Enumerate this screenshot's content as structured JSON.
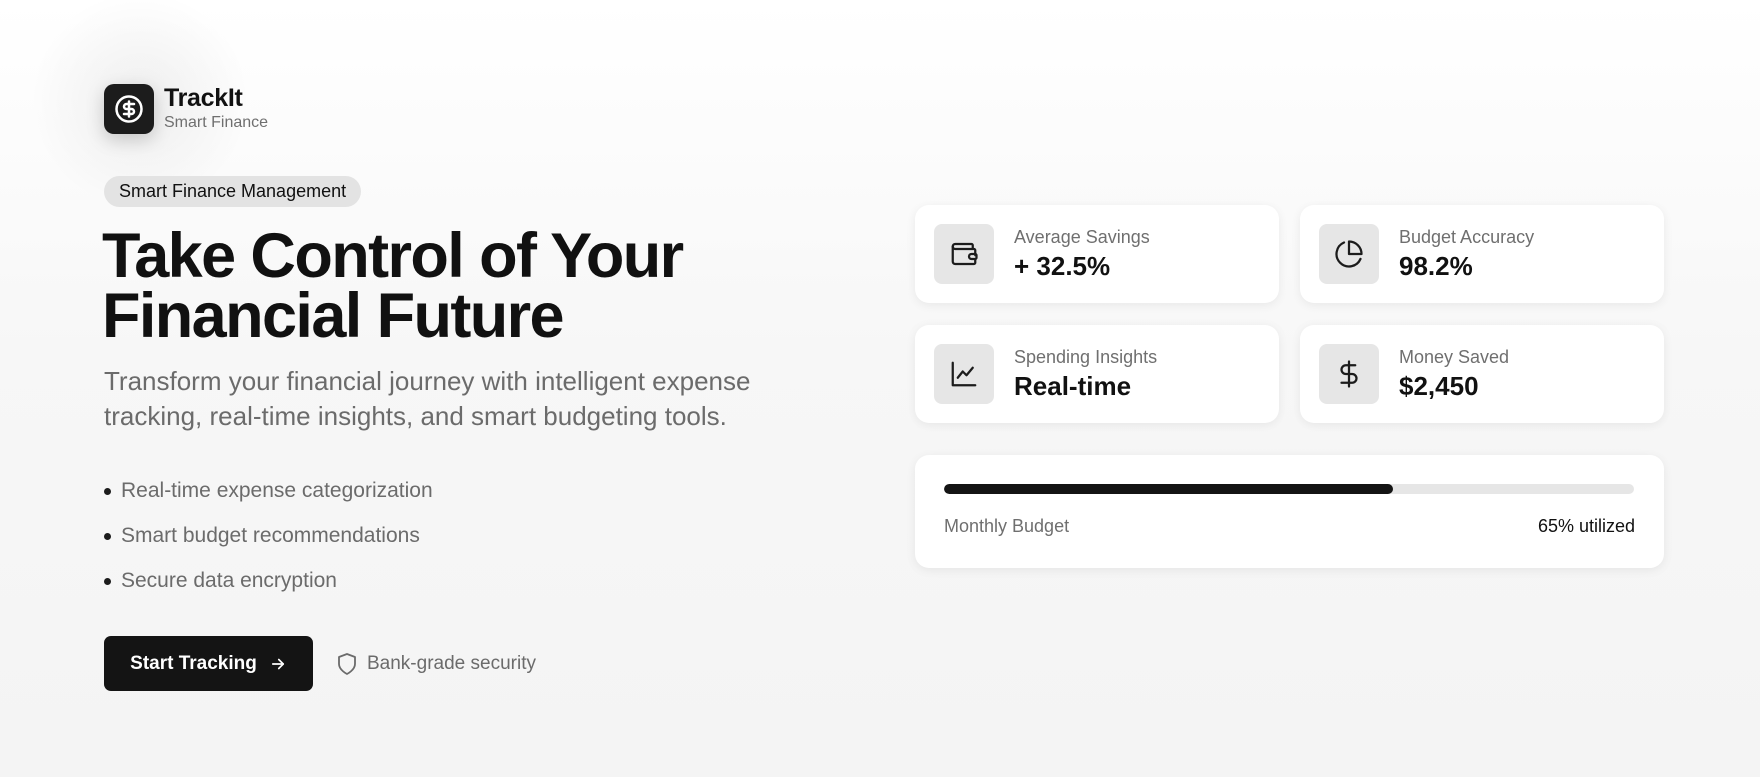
{
  "brand": {
    "name": "TrackIt",
    "tagline": "Smart Finance"
  },
  "hero": {
    "badge": "Smart Finance Management",
    "headline_line1": "Take Control of Your",
    "headline_line2": "Financial Future",
    "subtext": "Transform your financial journey with intelligent expense tracking, real-time insights, and smart budgeting tools.",
    "features": [
      "Real-time expense categorization",
      "Smart budget recommendations",
      "Secure data encryption"
    ],
    "cta_label": "Start Tracking",
    "security_note": "Bank-grade security"
  },
  "stats": [
    {
      "icon": "wallet-icon",
      "label": "Average Savings",
      "value": "+ 32.5%"
    },
    {
      "icon": "pie-chart-icon",
      "label": "Budget Accuracy",
      "value": "98.2%"
    },
    {
      "icon": "line-chart-icon",
      "label": "Spending Insights",
      "value": "Real-time"
    },
    {
      "icon": "dollar-icon",
      "label": "Money Saved",
      "value": "$2,450"
    }
  ],
  "budget": {
    "label": "Monthly Budget",
    "utilized_text": "65% utilized",
    "utilized_fraction": 0.65
  },
  "colors": {
    "primary": "#141414",
    "muted_text": "#6b6b6b",
    "icon_bg": "#e6e6e6",
    "track": "#e6e6e6"
  }
}
